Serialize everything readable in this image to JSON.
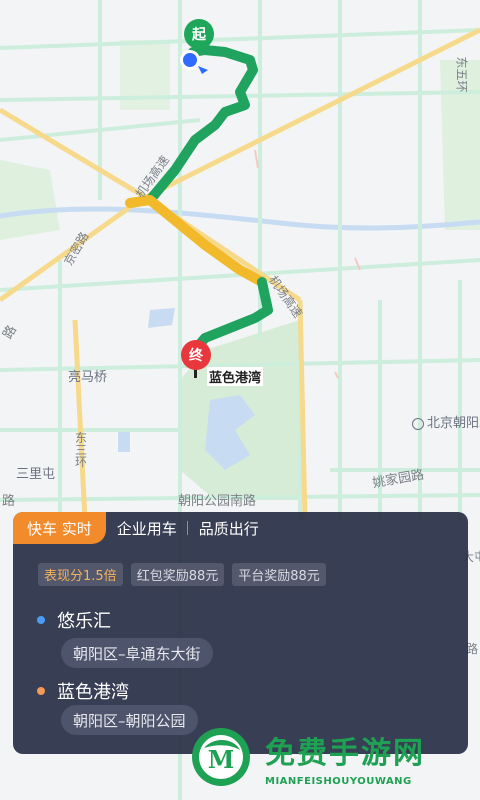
{
  "map": {
    "labels": {
      "airport_expressway": "机场高速",
      "airport_expressway_2": "机场高速",
      "jingmi_road": "京密路",
      "east_5th_ring": "东五环",
      "liangmaqiao": "亮马桥",
      "east_3rd_ring": "东三环",
      "sanlitun": "三里屯",
      "chaoyang_park_south_road": "朝阳公园南路",
      "yaojiayuan_road": "姚家园路",
      "beijing_chaoyang_station": "北京朝阳站",
      "lu_left": "路",
      "lu_left2": "路",
      "zhou_right": "大屯",
      "lu_right": "路"
    },
    "start_marker": "起",
    "end_marker": "终",
    "destination_label": "蓝色港湾",
    "colors": {
      "route_green": "#21a360",
      "route_yellow": "#f2b92a",
      "park_green": "#d6ecd6",
      "water": "#c7dcf2",
      "road": "#cdeedc",
      "major_road": "#f6d98b",
      "start_pin": "#1ea75a",
      "end_pin": "#e8383d",
      "location_dot": "#2f6bff"
    }
  },
  "panel": {
    "tabs": [
      "快车 实时",
      "企业用车",
      "品质出行"
    ],
    "chips": [
      "表现分1.5倍",
      "红包奖励88元",
      "平台奖励88元"
    ],
    "origin": {
      "name": "悠乐汇",
      "address": "朝阳区–阜通东大街",
      "dot_color": "#4a9cf5"
    },
    "destination": {
      "name": "蓝色港湾",
      "address": "朝阳区–朝阳公园",
      "dot_color": "#f29a5a"
    }
  },
  "watermark": {
    "text": "免费手游网",
    "subtext": "MIANFEISHOUYOUWANG",
    "logo_letter": "M"
  }
}
